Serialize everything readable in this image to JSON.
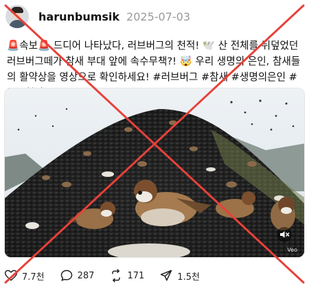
{
  "post": {
    "username": "harunbumsik",
    "date": "2025-07-03",
    "caption": "🚨속보🚨 드디어 나타났다, 러브버그의 천적! 🕊️ 산 전체를 뒤덮었던 러브버그떼가 참새 부대 앞에 속수무책?! 🤯 우리 생명의 은인, 참새들의 활약상을 영상으로 확인하세요! #러브버그 #참새 #생명의은인 #뉴스현장",
    "media_watermark": "Veo"
  },
  "actions": {
    "likes": "7.7천",
    "comments": "287",
    "reposts": "171",
    "shares": "1.5천"
  },
  "colors": {
    "cross": "#e8413a",
    "secondary_text": "#9a9a9a"
  },
  "icons": [
    "heart-icon",
    "comment-icon",
    "repost-icon",
    "share-icon",
    "mute-icon"
  ]
}
